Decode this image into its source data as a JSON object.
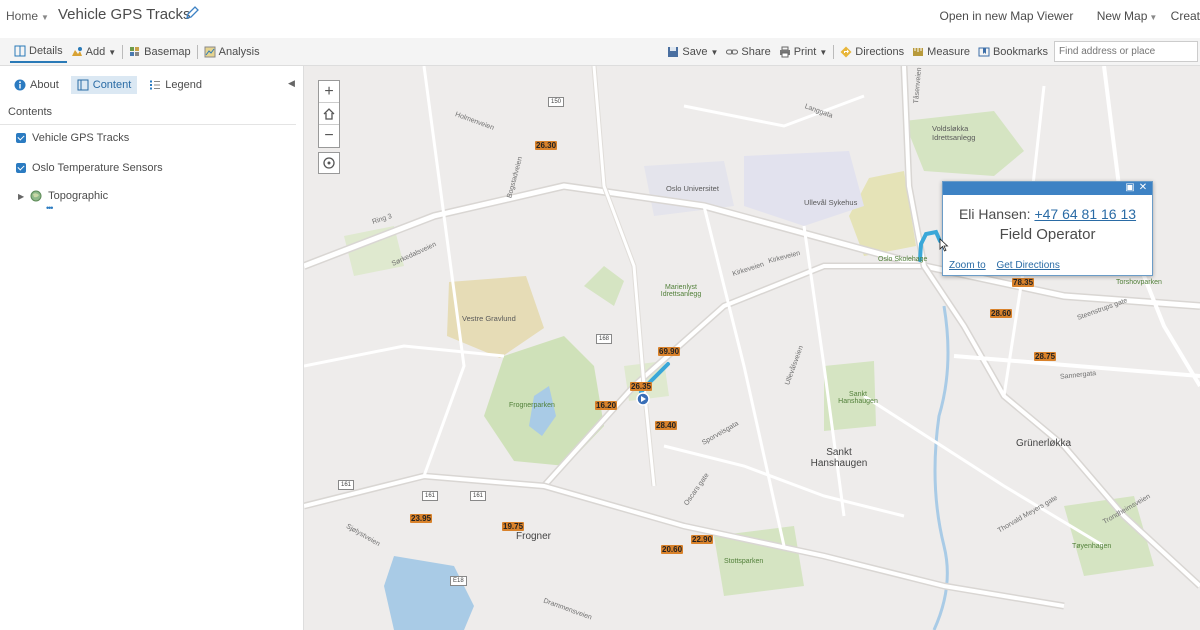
{
  "header": {
    "home_label": "Home",
    "map_title": "Vehicle GPS Tracks",
    "open_viewer": "Open in new Map Viewer",
    "new_map": "New Map",
    "create": "Creat"
  },
  "toolbar": {
    "details": "Details",
    "add": "Add",
    "basemap": "Basemap",
    "analysis": "Analysis",
    "save": "Save",
    "share": "Share",
    "print": "Print",
    "directions": "Directions",
    "measure": "Measure",
    "bookmarks": "Bookmarks",
    "search_placeholder": "Find address or place"
  },
  "panel": {
    "tabs": {
      "about": "About",
      "content": "Content",
      "legend": "Legend"
    },
    "heading": "Contents",
    "layers": [
      {
        "label": "Vehicle GPS Tracks"
      },
      {
        "label": "Oslo Temperature Sensors"
      },
      {
        "label": "Topographic"
      }
    ]
  },
  "popup": {
    "name": "Eli Hansen:",
    "phone": "+47 64 81 16 13",
    "role": "Field Operator",
    "zoom_to": "Zoom to",
    "get_directions": "Get Directions"
  },
  "map": {
    "temps": [
      "26.30",
      "69.90",
      "26.35",
      "16.20",
      "28.40",
      "78.35",
      "28.60",
      "28.75",
      "23.95",
      "19.75",
      "20.60",
      "22.90"
    ],
    "areas": {
      "vestre_gravlund": "Vestre Gravlund",
      "frognerparken": "Frognerparken",
      "oslo_universitet": "Oslo Universitet",
      "ulleval_sykehus": "Ullevål Sykehus",
      "marienlyst": "Marienlyst Idrettsanlegg",
      "voldslokka": "Voldsløkka Idrettsanlegg",
      "sankt_hanshaugen_park": "Sankt Hanshaugen",
      "sankt_hanshaugen": "Sankt Hanshaugen",
      "grunerlokka": "Grünerløkka",
      "frogner": "Frogner",
      "stottsparken": "Stottsparken",
      "toyenhagen": "Tøyenhagen",
      "oslo_skolehage": "Oslo Skolehage",
      "torshovparken": "Torshovparken"
    },
    "roads": {
      "ring3": "Ring 3",
      "kirkeveien1": "Kirkeveien",
      "kirkeveien2": "Kirkeveien",
      "sannergata": "Sannergata",
      "sorkedalsveien": "Sørkedalsveien",
      "bogstadveien": "Bogstadveien",
      "ullevalsveien": "Ullevålsveien",
      "tasenveien": "Tåsenveien",
      "sjolyst": "Sjølystveien",
      "drammensveien": "Drammensveien",
      "oscars_gate": "Oscars gate",
      "holmenveien": "Holmenveien",
      "sporveisgata": "Sporveisgata",
      "thorvald": "Thorvald Meyers gate",
      "trondheimsveien": "Trondheimsveien",
      "steenstrups": "Steenstrups gate",
      "langgata": "Langgata"
    },
    "shields": [
      "150",
      "168",
      "161",
      "161",
      "161",
      "E18"
    ]
  },
  "colors": {
    "accent": "#2a7ab7",
    "popup_header": "#3d82c4",
    "track": "#3aa7d8",
    "temp_label": "#d9822b"
  }
}
